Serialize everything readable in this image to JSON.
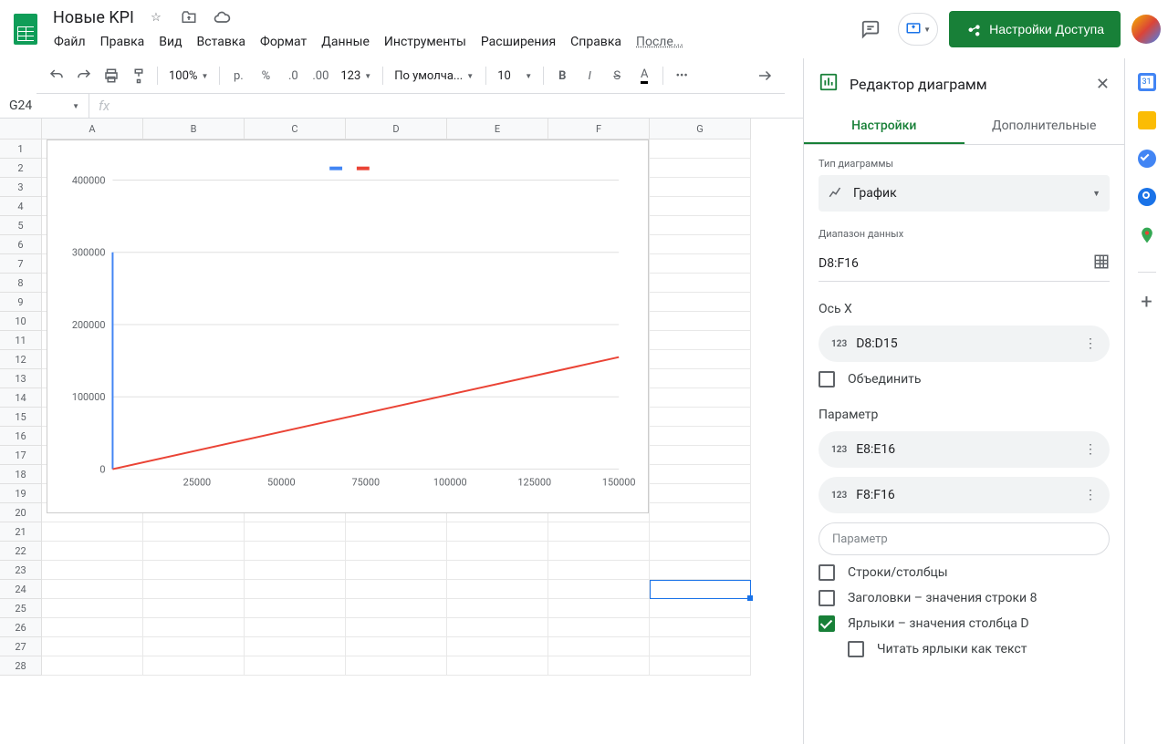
{
  "doc": {
    "title": "Новые KPI"
  },
  "menus": [
    "Файл",
    "Правка",
    "Вид",
    "Вставка",
    "Формат",
    "Данные",
    "Инструменты",
    "Расширения",
    "Справка",
    "После..."
  ],
  "share": {
    "label": "Настройки Доступа"
  },
  "toolbar": {
    "zoom": "100%",
    "currency": "р.",
    "percent": "%",
    "font": "По умолча...",
    "size": "10",
    "more": "•••"
  },
  "formula": {
    "cell": "G24",
    "fx": "fx"
  },
  "cols": [
    "A",
    "B",
    "C",
    "D",
    "E",
    "F",
    "G"
  ],
  "rows": 28,
  "selected_cell": {
    "col": 6,
    "row": 23,
    "colLetter": "G"
  },
  "chart_data": {
    "type": "line",
    "x": [
      0,
      25000,
      50000,
      75000,
      100000,
      125000,
      150000
    ],
    "xlim": [
      0,
      150000
    ],
    "ylim": [
      0,
      400000
    ],
    "yticks": [
      0,
      100000,
      200000,
      300000,
      400000
    ],
    "series": [
      {
        "name": "",
        "color": "#4285f4",
        "values": [
          [
            0,
            0
          ],
          [
            0,
            300000
          ]
        ]
      },
      {
        "name": "",
        "color": "#ea4335",
        "values": [
          [
            0,
            0
          ],
          [
            150000,
            155000
          ]
        ]
      }
    ],
    "legend": [
      "",
      ""
    ]
  },
  "panel": {
    "title": "Редактор диаграмм",
    "tabs": {
      "setup": "Настройки",
      "customize": "Дополнительные"
    },
    "chart_type_label": "Тип диаграммы",
    "chart_type": "График",
    "data_range_label": "Диапазон данных",
    "data_range": "D8:F16",
    "xaxis_label": "Ось X",
    "xaxis_value": "D8:D15",
    "aggregate": "Объединить",
    "series_label": "Параметр",
    "series": [
      "E8:E16",
      "F8:F16"
    ],
    "add_series_placeholder": "Параметр",
    "checks": {
      "switch": "Строки/столбцы",
      "headers": "Заголовки – значения строки 8",
      "labels": "Ярлыки – значения столбца D",
      "treat_as_text": "Читать ярлыки как текст"
    }
  }
}
